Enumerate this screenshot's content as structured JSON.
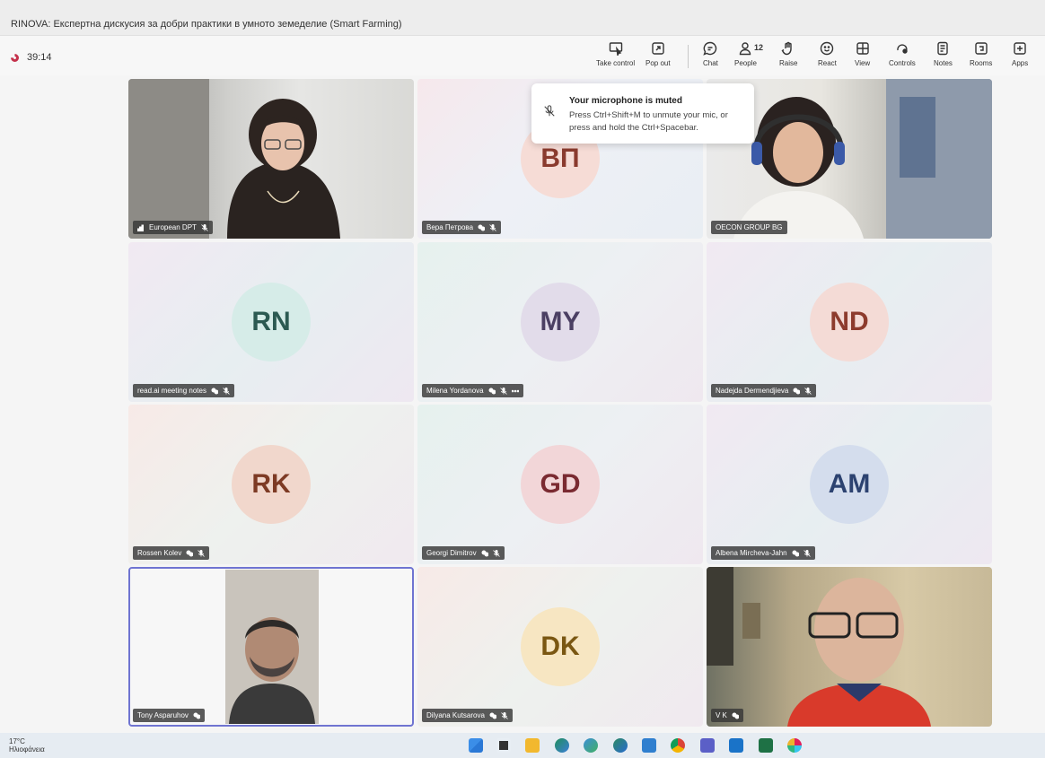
{
  "window": {
    "title": "RINOVA: Експертна дискусия за добри практики в умното земеделие (Smart Farming)"
  },
  "meeting": {
    "timer": "39:14"
  },
  "toolbar": {
    "take_control": "Take control",
    "pop_out": "Pop out",
    "chat": "Chat",
    "people": "People",
    "people_count": "12",
    "raise": "Raise",
    "react": "React",
    "view": "View",
    "controls": "Controls",
    "notes": "Notes",
    "rooms": "Rooms",
    "apps": "Apps"
  },
  "toast": {
    "title": "Your microphone is muted",
    "body": "Press Ctrl+Shift+M to unmute your mic, or press and hold the Ctrl+Spacebar."
  },
  "participants": [
    {
      "name": "European DPT",
      "initials": "",
      "video": true
    },
    {
      "name": "Вера Петрова",
      "initials": "ВП",
      "avatar_bg": "#f6dcd6",
      "avatar_fg": "#8a3a2e"
    },
    {
      "name": "OECON GROUP BG",
      "initials": "",
      "video": true
    },
    {
      "name": "read.ai meeting notes",
      "initials": "RN",
      "avatar_bg": "#d6ece8",
      "avatar_fg": "#2c5a52"
    },
    {
      "name": "Milena Yordanova",
      "initials": "MY",
      "avatar_bg": "#e2dcea",
      "avatar_fg": "#4b3f63"
    },
    {
      "name": "Nadejda Dermendjieva",
      "initials": "ND",
      "avatar_bg": "#f4dbd6",
      "avatar_fg": "#8d3b2d"
    },
    {
      "name": "Rossen Kolev",
      "initials": "RK",
      "avatar_bg": "#f1d7cc",
      "avatar_fg": "#7d3a24"
    },
    {
      "name": "Georgi Dimitrov",
      "initials": "GD",
      "avatar_bg": "#f2d6d8",
      "avatar_fg": "#7a2a31"
    },
    {
      "name": "Albena Mircheva-Jahn",
      "initials": "AM",
      "avatar_bg": "#d4dded",
      "avatar_fg": "#2c4270"
    },
    {
      "name": "Tony Asparuhov",
      "initials": "",
      "video": true
    },
    {
      "name": "Dilyana Kutsarova",
      "initials": "DK",
      "avatar_bg": "#f7e6c2",
      "avatar_fg": "#7a5712"
    },
    {
      "name": "V K",
      "initials": "",
      "video": true
    }
  ],
  "taskbar": {
    "temperature": "17°C",
    "weather": "Ηλιοφάνεια"
  },
  "colors": {
    "accent": "#6f74d1",
    "recording": "#c4314b"
  }
}
